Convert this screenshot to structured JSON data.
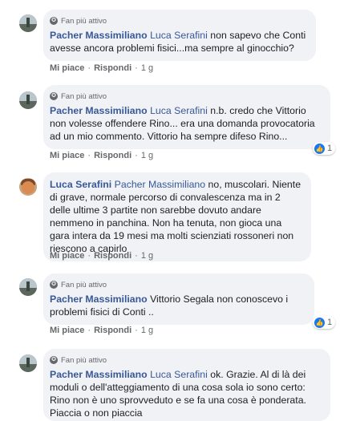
{
  "labels": {
    "badge": "Fan più attivo",
    "like": "Mi piace",
    "reply": "Rispondi",
    "separator": "·"
  },
  "comments": [
    {
      "author": "Pacher Massimiliano",
      "mention": "Luca Serafini",
      "text": " non sapevo che Conti avesse ancora problemi fisici...ma sempre al ginocchio?",
      "time": "1 g",
      "reactions": null
    },
    {
      "author": "Pacher Massimiliano",
      "mention": "Luca Serafini",
      "text": " n.b. credo che Vittorio non volesse offendere Rino... era una domanda provocatoria ad un mio commento. Vittorio ha sempre difeso Rino...",
      "time": "1 g",
      "reactions": "1"
    },
    {
      "author": "Luca Serafini",
      "mention": "Pacher Massimiliano",
      "text": " no, muscolari. Niente di grave, normale percorso di convalescenza ma in 2 delle ultime 3 partite non sarebbe dovuto andare nemmeno in panchina. Non ha tenuta, non gioca una gara intera da 19 mesi ma molti scienziati rossoneri non riescono a capirlo",
      "time": "1 g",
      "reactions": null
    },
    {
      "author": "Pacher Massimiliano",
      "mention": "",
      "text": "Vittorio Segala non conoscevo i problemi fisici di Conti ..",
      "time": "1 g",
      "reactions": "1"
    },
    {
      "author": "Pacher Massimiliano",
      "mention": "Luca Serafini",
      "text": " ok. Grazie. Al di là dei moduli o dell'atteggiamento di una cosa sola io sono certo: Rino non è uno sprovveduto e se fa una cosa è ponderata. Piaccia o non piaccia",
      "time": "",
      "reactions": null
    }
  ]
}
